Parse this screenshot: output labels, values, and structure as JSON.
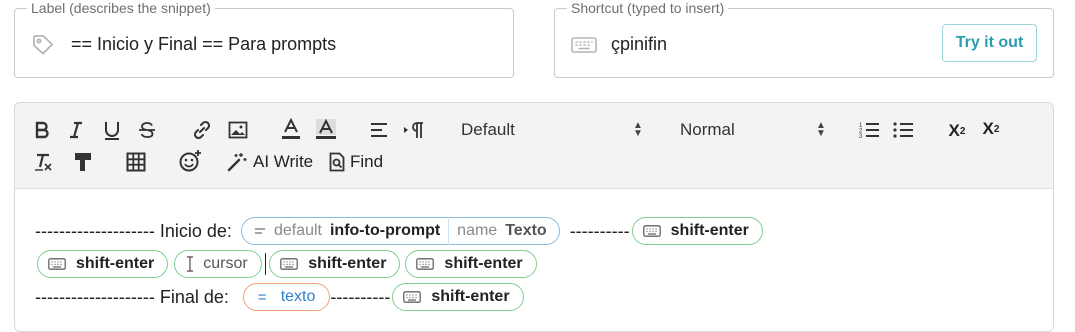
{
  "label_field": {
    "legend": "Label (describes the snippet)",
    "value": "== Inicio y Final  == Para prompts",
    "icon": "tag-icon"
  },
  "shortcut_field": {
    "legend": "Shortcut (typed to insert)",
    "value": "çpinifin",
    "icon": "keyboard-icon",
    "try_label": "Try it out"
  },
  "toolbar": {
    "buttons": [
      "bold",
      "italic",
      "underline",
      "strikethrough",
      "link",
      "image",
      "text-color",
      "highlight",
      "align",
      "text-direction",
      "ordered-list",
      "bullet-list",
      "subscript",
      "superscript",
      "clear-format",
      "format-painter",
      "table",
      "emoji"
    ],
    "font_family": "Default",
    "font_size": "Normal",
    "ai_write_label": "AI Write",
    "find_label": "Find",
    "subscript_label": "X",
    "subscript_sub": "2",
    "superscript_label": "X",
    "superscript_sup": "2",
    "clear_label": "T"
  },
  "content": {
    "line1_prefix": "-------------------- Inicio de:",
    "prompt_chip": {
      "label1": "default",
      "value1": "info-to-prompt",
      "label2": "name",
      "value2": "Texto"
    },
    "line1_dashes": "----------",
    "shift_enter": "shift-enter",
    "cursor_label": "cursor",
    "line3_prefix": "-------------------- Final de:",
    "texto_chip_symbol": "=",
    "texto_chip_value": "texto",
    "line3_dashes": "----------"
  },
  "colors": {
    "accent": "#2a9db0",
    "chip_green": "#7fcf8f",
    "chip_blue": "#8cbbe0",
    "chip_orange": "#f0a27a"
  }
}
